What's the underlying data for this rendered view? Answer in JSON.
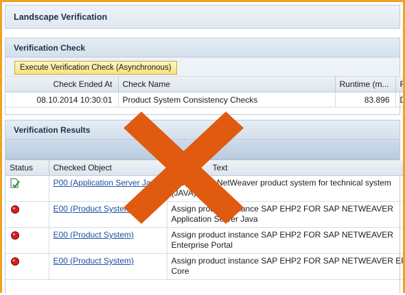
{
  "window": {
    "title": "Landscape Verification"
  },
  "verification_check": {
    "heading": "Verification Check",
    "execute_button": "Execute Verification Check (Asynchronous)",
    "columns": [
      "Check Ended At",
      "Check Name",
      "Runtime (m...",
      "F"
    ],
    "rows": [
      {
        "ended_at": "08.10.2014 10:30:01",
        "name": "Product System Consistency Checks",
        "runtime": "83.896",
        "extra": "D"
      }
    ]
  },
  "verification_results": {
    "heading": "Verification Results",
    "columns": [
      "Status",
      "Checked Object",
      "Text"
    ],
    "rows": [
      {
        "status_icon": "check-document-icon",
        "object": "P00 (Application Server Java)",
        "text": "Create SAP NetWeaver product system for technical system (JAVA)"
      },
      {
        "status_icon": "error-icon",
        "object": "E00 (Product System)",
        "text": "Assign product instance SAP EHP2 FOR SAP NETWEAVER Application Server Java"
      },
      {
        "status_icon": "error-icon",
        "object": "E00 (Product System)",
        "text": "Assign product instance SAP EHP2 FOR SAP NETWEAVER Enterprise Portal"
      },
      {
        "status_icon": "error-icon",
        "object": "E00 (Product System)",
        "text": "Assign product instance SAP EHP2 FOR SAP NETWEAVER EP Core"
      }
    ]
  },
  "overlay": {
    "icon": "cross-mark-icon",
    "color": "#e05a10"
  },
  "colors": {
    "accent": "#f0a21e",
    "link": "#1b4fa0",
    "error": "#d81c1c"
  }
}
